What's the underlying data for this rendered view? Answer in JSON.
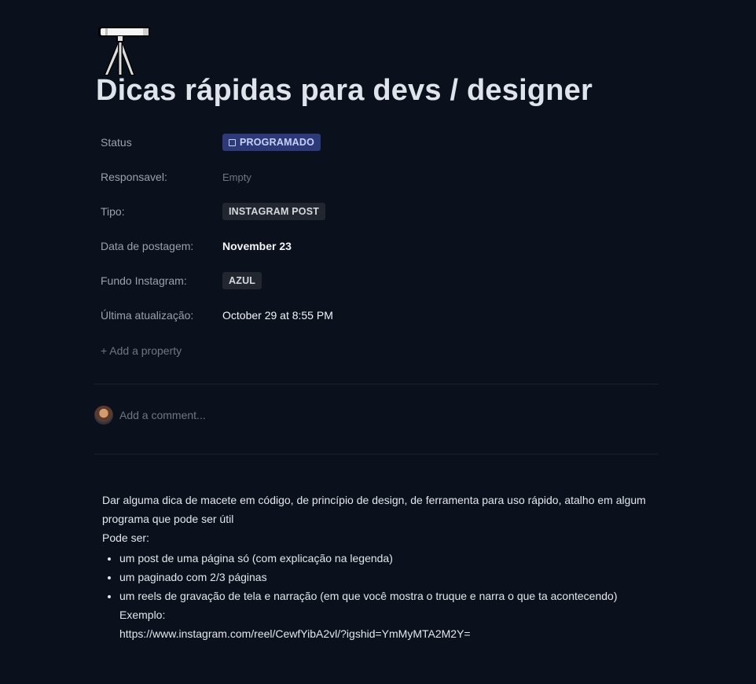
{
  "page": {
    "icon": "telescope-icon",
    "title": "Dicas rápidas para devs / designer"
  },
  "properties": {
    "status": {
      "label": "Status",
      "value": "PROGRAMADO",
      "color": "#2d3a7a"
    },
    "responsavel": {
      "label": "Responsavel:",
      "value": "Empty"
    },
    "tipo": {
      "label": "Tipo:",
      "value": "INSTAGRAM POST"
    },
    "data_postagem": {
      "label": "Data de postagem:",
      "value": "November 23"
    },
    "fundo_instagram": {
      "label": "Fundo Instagram:",
      "value": "AZUL"
    },
    "ultima_atualizacao": {
      "label": "Última atualização:",
      "value": "October 29 at 8:55 PM"
    },
    "add_property": "+ Add a property"
  },
  "comments": {
    "placeholder": "Add a comment..."
  },
  "content": {
    "paragraph_1": "Dar alguma dica de macete em código, de princípio de design, de ferramenta para uso rápido, atalho em algum programa que pode ser útil",
    "paragraph_2": "Pode ser:",
    "bullets": [
      "um post de uma página só (com explicação na legenda)",
      "um paginado com 2/3 páginas",
      "um reels de gravação de tela e narração (em que você mostra o truque e narra o que ta acontecendo)"
    ],
    "example_label": "Exemplo:",
    "example_link": "https://www.instagram.com/reel/CewfYibA2vl/?igshid=YmMyMTA2M2Y="
  }
}
